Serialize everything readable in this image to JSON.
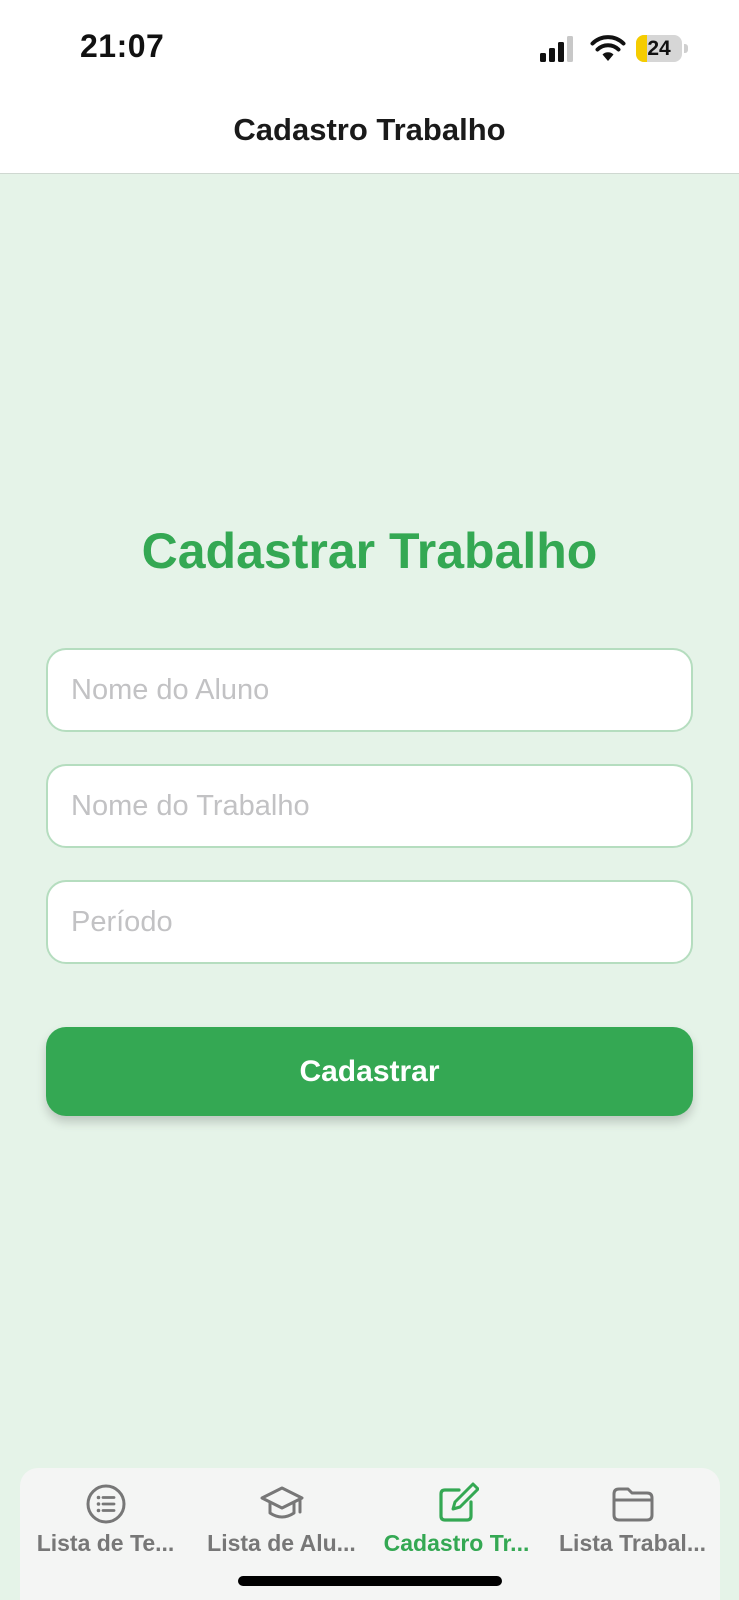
{
  "status_bar": {
    "time": "21:07",
    "battery_level": "24",
    "battery_fraction": 0.24,
    "icons": [
      "signal-icon",
      "wifi-icon",
      "battery-icon"
    ]
  },
  "header": {
    "title": "Cadastro Trabalho"
  },
  "form": {
    "heading": "Cadastrar Trabalho",
    "fields": [
      {
        "placeholder": "Nome do Aluno",
        "value": ""
      },
      {
        "placeholder": "Nome do Trabalho",
        "value": ""
      },
      {
        "placeholder": "Período",
        "value": ""
      }
    ],
    "submit_label": "Cadastrar"
  },
  "tabs": [
    {
      "label": "Lista de Te...",
      "icon": "list-icon",
      "active": false
    },
    {
      "label": "Lista de Alu...",
      "icon": "graduation-cap-icon",
      "active": false
    },
    {
      "label": "Cadastro Tr...",
      "icon": "edit-icon",
      "active": true
    },
    {
      "label": "Lista Trabal...",
      "icon": "folder-icon",
      "active": false
    }
  ],
  "colors": {
    "accent": "#34a853",
    "background": "#e5f3e8",
    "field_border": "#b5ddbf",
    "inactive_tab": "#777777"
  }
}
